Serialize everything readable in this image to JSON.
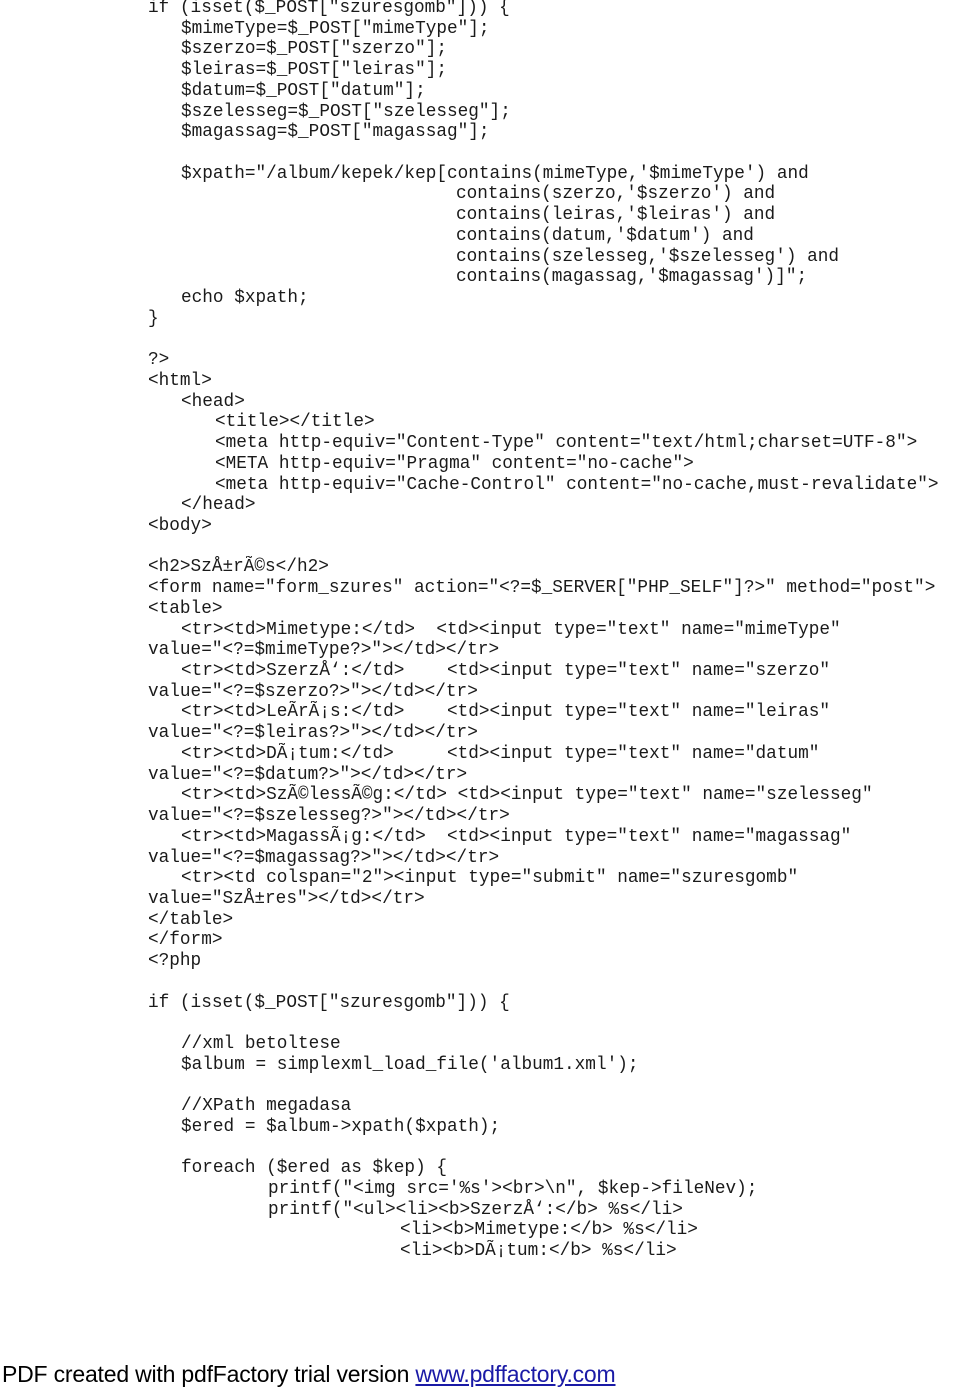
{
  "document": {
    "type": "php-source-listing",
    "lines": [
      "if (isset($_POST[\"szuresgomb\"])) {",
      "$mimeType=$_POST[\"mimeType\"];",
      "$szerzo=$_POST[\"szerzo\"];",
      "$leiras=$_POST[\"leiras\"];",
      "$datum=$_POST[\"datum\"];",
      "$szelesseg=$_POST[\"szelesseg\"];",
      "$magassag=$_POST[\"magassag\"];",
      "",
      "$xpath=\"/album/kepek/kep[contains(mimeType,'$mimeType') and",
      "contains(szerzo,'$szerzo') and",
      "contains(leiras,'$leiras') and",
      "contains(datum,'$datum') and",
      "contains(szelesseg,'$szelesseg') and",
      "contains(magassag,'$magassag')]\";",
      "echo $xpath;",
      "}",
      "",
      "?>",
      "<html>",
      "<head>",
      "<title></title>",
      "<meta http-equiv=\"Content-Type\" content=\"text/html;charset=UTF-8\">",
      "<META http-equiv=\"Pragma\" content=\"no-cache\">",
      "<meta http-equiv=\"Cache-Control\" content=\"no-cache,must-revalidate\">",
      "</head>",
      "<body>",
      "",
      "<h2>SzÅ±rÃ©s</h2>",
      "<form name=\"form_szures\" action=\"<?=$_SERVER[\"PHP_SELF\"]?>\" method=\"post\">",
      "<table>",
      "<tr><td>Mimetype:</td>  <td><input type=\"text\" name=\"mimeType\"",
      "value=\"<?=$mimeType?>\"></td></tr>",
      "<tr><td>SzerzÅ‘:</td>    <td><input type=\"text\" name=\"szerzo\"",
      "value=\"<?=$szerzo?>\"></td></tr>",
      "<tr><td>LeÃ­rÃ¡s:</td>    <td><input type=\"text\" name=\"leiras\"",
      "value=\"<?=$leiras?>\"></td></tr>",
      "<tr><td>DÃ¡tum:</td>     <td><input type=\"text\" name=\"datum\"",
      "value=\"<?=$datum?>\"></td></tr>",
      "<tr><td>SzÃ©lessÃ©g:</td> <td><input type=\"text\" name=\"szelesseg\"",
      "value=\"<?=$szelesseg?>\"></td></tr>",
      "<tr><td>MagassÃ¡g:</td>  <td><input type=\"text\" name=\"magassag\"",
      "value=\"<?=$magassag?>\"></td></tr>",
      "<tr><td colspan=\"2\"><input type=\"submit\" name=\"szuresgomb\"",
      "value=\"SzÅ±res\"></td></tr>",
      "</table>",
      "</form>",
      "<?php",
      "",
      "if (isset($_POST[\"szuresgomb\"])) {",
      "",
      "//xml betoltese",
      "$album = simplexml_load_file('album1.xml');",
      "",
      "//XPath megadasa",
      "$ered = $album->xpath($xpath);",
      "",
      "foreach ($ered as $kep) {",
      "printf(\"<img src='%s'><br>\\n\", $kep->fileNev);",
      "printf(\"<ul><li><b>SzerzÅ‘:</b> %s</li>",
      "<li><b>Mimetype:</b> %s</li>",
      "<li><b>DÃ¡tum:</b> %s</li>"
    ]
  },
  "footer": {
    "text": "PDF created with pdfFactory trial version ",
    "link_text": "www.pdffactory.com",
    "link_color": "#1a1aa6"
  }
}
